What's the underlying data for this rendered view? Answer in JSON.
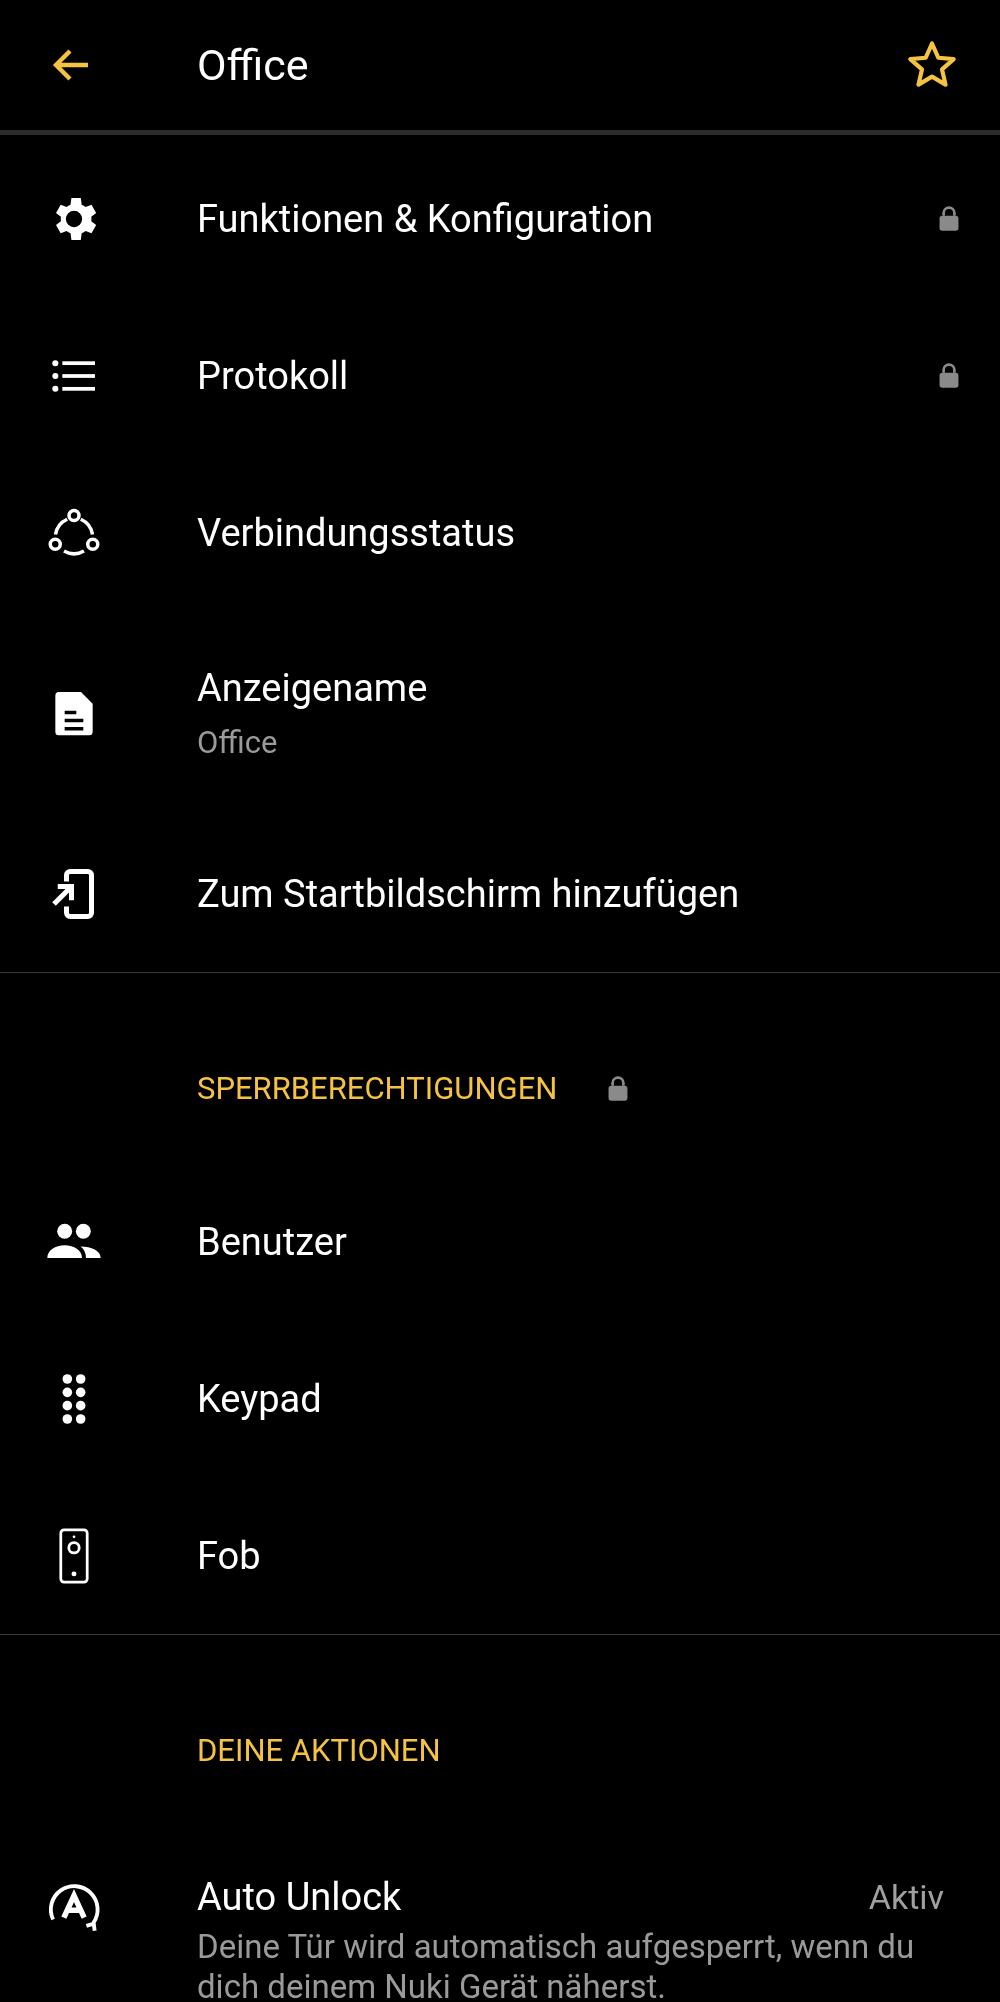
{
  "header": {
    "title": "Office",
    "favorite": false
  },
  "sections": [
    {
      "items": [
        {
          "title": "Funktionen & Konfiguration",
          "locked": true
        },
        {
          "title": "Protokoll",
          "locked": true
        },
        {
          "title": "Verbindungsstatus",
          "locked": false
        },
        {
          "title": "Anzeigename",
          "subtitle": "Office",
          "locked": false
        },
        {
          "title": "Zum Startbildschirm hinzufügen",
          "locked": false
        }
      ]
    },
    {
      "heading": "SPERRBERECHTIGUNGEN",
      "heading_locked": true,
      "items": [
        {
          "title": "Benutzer",
          "locked": false
        },
        {
          "title": "Keypad",
          "locked": false
        },
        {
          "title": "Fob",
          "locked": false
        }
      ]
    },
    {
      "heading": "DEINE AKTIONEN",
      "heading_locked": false,
      "items": [
        {
          "title": "Auto Unlock",
          "status": "Aktiv",
          "description": "Deine Tür wird automatisch aufgesperrt, wenn du dich deinem Nuki Gerät näherst.",
          "locked": false
        }
      ]
    }
  ]
}
